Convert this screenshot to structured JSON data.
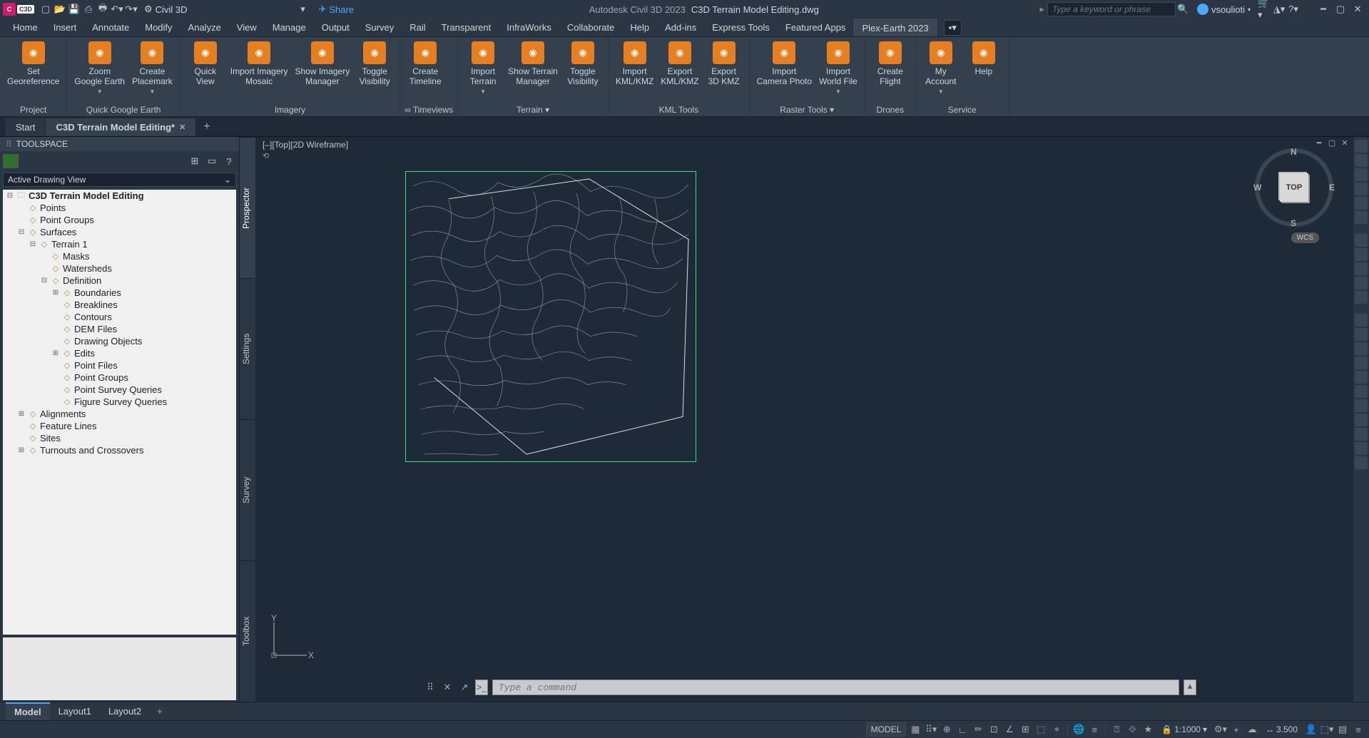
{
  "titlebar": {
    "logo": "C",
    "badge": "C3D",
    "workspace": "Civil 3D",
    "share": "Share",
    "app": "Autodesk Civil 3D 2023",
    "doc": "C3D Terrain Model Editing.dwg",
    "search_placeholder": "Type a keyword or phrase",
    "user": "vsoulioti"
  },
  "menu": {
    "tabs": [
      "Home",
      "Insert",
      "Annotate",
      "Modify",
      "Analyze",
      "View",
      "Manage",
      "Output",
      "Survey",
      "Rail",
      "Transparent",
      "InfraWorks",
      "Collaborate",
      "Help",
      "Add-ins",
      "Express Tools",
      "Featured Apps",
      "Plex-Earth 2023"
    ],
    "active": "Plex-Earth 2023"
  },
  "ribbon": {
    "panels": [
      {
        "label": "Project",
        "buttons": [
          {
            "text": "Set\nGeoreference"
          }
        ]
      },
      {
        "label": "Quick Google Earth",
        "buttons": [
          {
            "text": "Zoom\nGoogle Earth",
            "caret": true
          },
          {
            "text": "Create\nPlacemark",
            "caret": true
          }
        ]
      },
      {
        "label": "Imagery",
        "buttons": [
          {
            "text": "Quick\nView"
          },
          {
            "text": "Import Imagery\nMosaic"
          },
          {
            "text": "Show Imagery\nManager"
          },
          {
            "text": "Toggle\nVisibility"
          }
        ]
      },
      {
        "label": "∞ Timeviews",
        "dropdown": true,
        "buttons": [
          {
            "text": "Create\nTimeline"
          }
        ]
      },
      {
        "label": "Terrain ▾",
        "buttons": [
          {
            "text": "Import\nTerrain",
            "caret": true
          },
          {
            "text": "Show Terrain\nManager"
          },
          {
            "text": "Toggle\nVisibility"
          }
        ]
      },
      {
        "label": "KML Tools",
        "buttons": [
          {
            "text": "Import\nKML/KMZ"
          },
          {
            "text": "Export\nKML/KMZ"
          },
          {
            "text": "Export\n3D KMZ"
          }
        ]
      },
      {
        "label": "Raster Tools ▾",
        "buttons": [
          {
            "text": "Import\nCamera Photo"
          },
          {
            "text": "Import\nWorld File",
            "caret": true
          }
        ]
      },
      {
        "label": "Drones",
        "buttons": [
          {
            "text": "Create\nFlight"
          }
        ]
      },
      {
        "label": "Service",
        "buttons": [
          {
            "text": "My\nAccount",
            "caret": true
          },
          {
            "text": "Help"
          }
        ]
      }
    ]
  },
  "drawtabs": {
    "tabs": [
      {
        "label": "Start",
        "close": false
      },
      {
        "label": "C3D Terrain Model Editing*",
        "close": true
      }
    ],
    "active": 1
  },
  "toolspace": {
    "title": "TOOLSPACE",
    "dropdown": "Active Drawing View",
    "tree": {
      "root": "C3D Terrain Model Editing",
      "children": [
        {
          "label": "Points"
        },
        {
          "label": "Point Groups"
        },
        {
          "label": "Surfaces",
          "expanded": true,
          "children": [
            {
              "label": "Terrain 1",
              "expanded": true,
              "children": [
                {
                  "label": "Masks"
                },
                {
                  "label": "Watersheds"
                },
                {
                  "label": "Definition",
                  "expanded": true,
                  "children": [
                    {
                      "label": "Boundaries",
                      "plus": true
                    },
                    {
                      "label": "Breaklines"
                    },
                    {
                      "label": "Contours"
                    },
                    {
                      "label": "DEM Files"
                    },
                    {
                      "label": "Drawing Objects"
                    },
                    {
                      "label": "Edits",
                      "plus": true
                    },
                    {
                      "label": "Point Files"
                    },
                    {
                      "label": "Point Groups"
                    },
                    {
                      "label": "Point Survey Queries"
                    },
                    {
                      "label": "Figure Survey Queries"
                    }
                  ]
                }
              ]
            }
          ]
        },
        {
          "label": "Alignments",
          "plus": true
        },
        {
          "label": "Feature Lines"
        },
        {
          "label": "Sites"
        },
        {
          "label": "Turnouts and Crossovers",
          "plus": true
        }
      ]
    },
    "vtabs": [
      "Prospector",
      "Settings",
      "Survey",
      "Toolbox"
    ],
    "vtab_active": 0
  },
  "canvas": {
    "header": "[–][Top][2D Wireframe]",
    "navcube": "TOP",
    "wcs": "WCS"
  },
  "cmdline": {
    "placeholder": "Type a command"
  },
  "layouttabs": {
    "tabs": [
      "Model",
      "Layout1",
      "Layout2"
    ],
    "active": 0
  },
  "statusbar": {
    "model": "MODEL",
    "scale": "1:1000",
    "decimal": "3.500"
  }
}
